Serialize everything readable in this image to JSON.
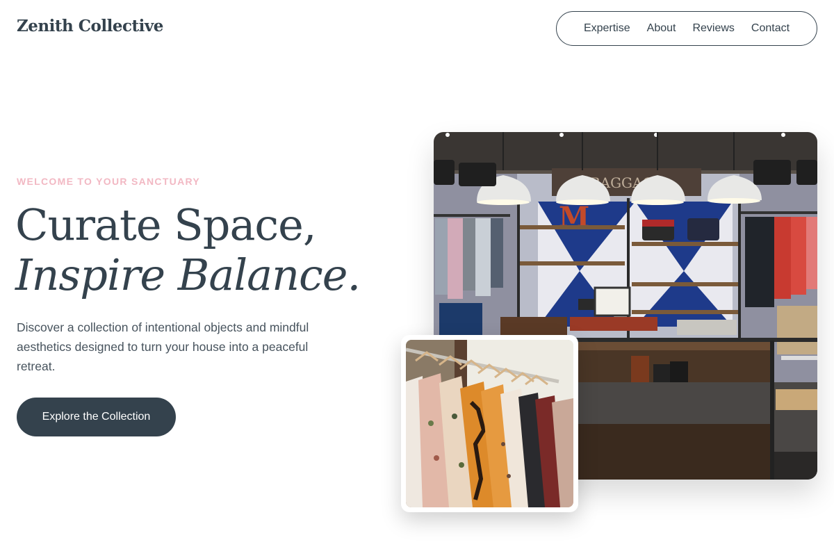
{
  "header": {
    "brand": "Zenith Collective",
    "nav": [
      "Expertise",
      "About",
      "Reviews",
      "Contact"
    ]
  },
  "hero": {
    "eyebrow": "WELCOME TO YOUR SANCTUARY",
    "headline_line1": "Curate Space,",
    "headline_line2": "Inspire Balance.",
    "lead": "Discover a collection of intentional objects and mindful aesthetics designed to turn your house into a peaceful retreat.",
    "cta_label": "Explore the Collection"
  },
  "images": {
    "main": "clothing-store-interior-photo",
    "secondary": "clothing-rack-photo"
  },
  "colors": {
    "primary": "#34424d",
    "accent": "#f2b8c3",
    "background": "#ffffff"
  }
}
